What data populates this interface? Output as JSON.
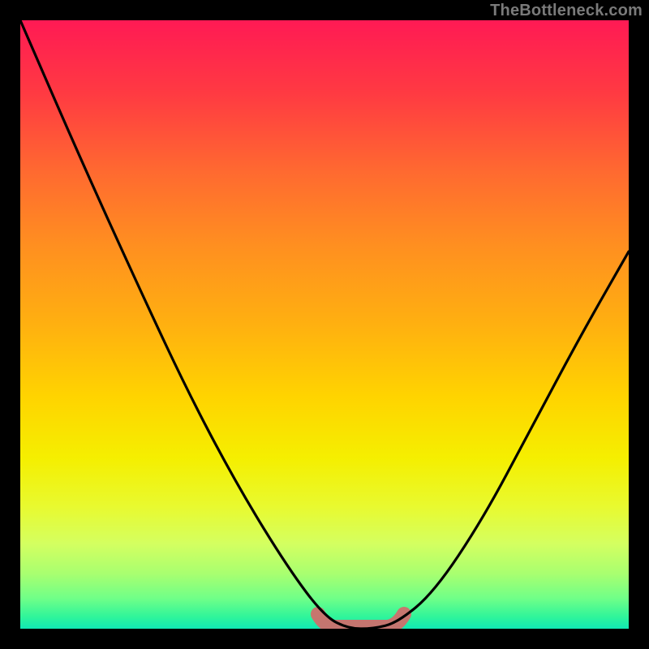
{
  "watermark": "TheBottleneck.com",
  "colors": {
    "curve": "#000000",
    "marker": "#d46a6a",
    "background_black": "#000000"
  },
  "chart_data": {
    "type": "line",
    "title": "",
    "xlabel": "",
    "ylabel": "",
    "xlim": [
      0,
      100
    ],
    "ylim": [
      0,
      100
    ],
    "grid": false,
    "legend": false,
    "series": [
      {
        "name": "main-curve",
        "x": [
          0,
          10,
          20,
          28,
          36,
          44,
          50,
          54,
          58,
          62,
          68,
          76,
          84,
          92,
          100
        ],
        "y": [
          100,
          77,
          55,
          38,
          23,
          10,
          2,
          0,
          0,
          1,
          6,
          18,
          33,
          48,
          62
        ]
      }
    ],
    "optimal_zone": {
      "x_start": 50,
      "x_end": 62,
      "y": 0
    }
  }
}
